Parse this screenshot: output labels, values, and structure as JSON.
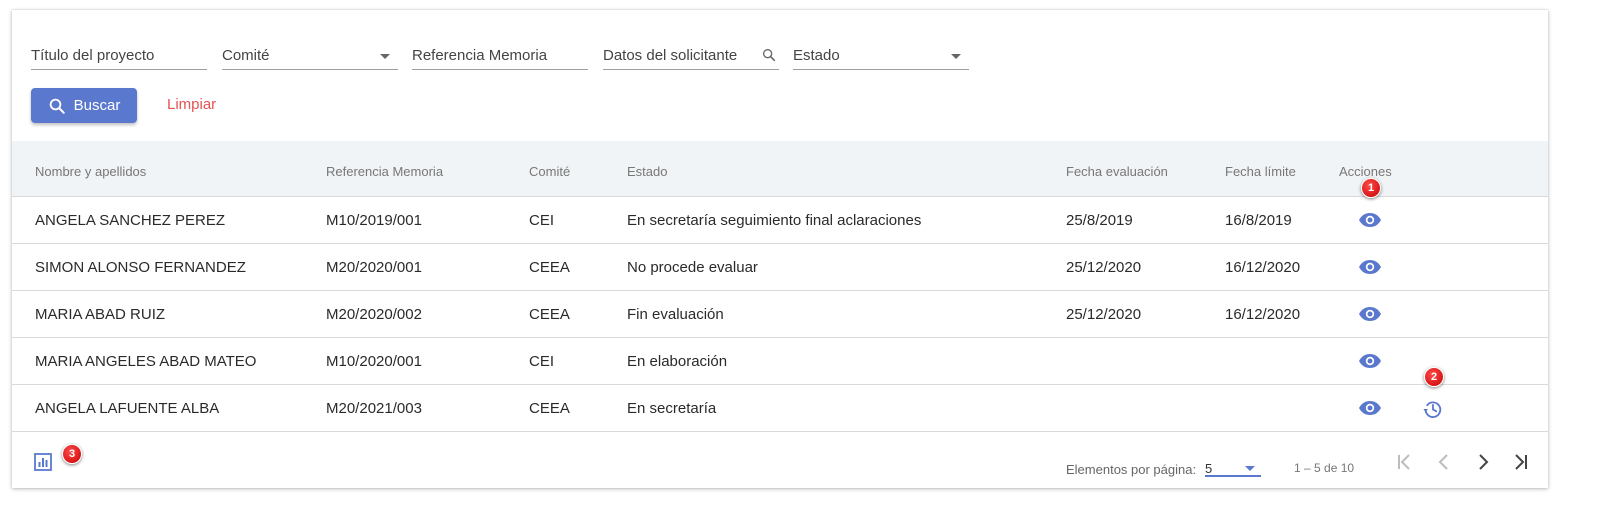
{
  "filters": {
    "titulo": "Título del proyecto",
    "comite": "Comité",
    "referencia": "Referencia Memoria",
    "solicitante": "Datos del solicitante",
    "estado": "Estado"
  },
  "buttons": {
    "buscar": "Buscar",
    "limpiar": "Limpiar"
  },
  "table": {
    "headers": [
      "Nombre y apellidos",
      "Referencia Memoria",
      "Comité",
      "Estado",
      "Fecha evaluación",
      "Fecha límite",
      "Acciones"
    ],
    "rows": [
      [
        "ANGELA SANCHEZ PEREZ",
        "M10/2019/001",
        "CEI",
        "En secretaría seguimiento final aclaraciones",
        "25/8/2019",
        "16/8/2019"
      ],
      [
        "SIMON ALONSO FERNANDEZ",
        "M20/2020/001",
        "CEEA",
        "No procede evaluar",
        "25/12/2020",
        "16/12/2020"
      ],
      [
        "MARIA ABAD RUIZ",
        "M20/2020/002",
        "CEEA",
        "Fin evaluación",
        "25/12/2020",
        "16/12/2020"
      ],
      [
        "MARIA ANGELES ABAD MATEO",
        "M10/2020/001",
        "CEI",
        "En elaboración",
        "",
        ""
      ],
      [
        "ANGELA LAFUENTE ALBA",
        "M20/2021/003",
        "CEEA",
        "En secretaría",
        "",
        ""
      ]
    ]
  },
  "markers": [
    "1",
    "2",
    "3"
  ],
  "paginator": {
    "label": "Elementos por página:",
    "page_size": "5",
    "range": "1 – 5 de 10"
  },
  "colors": {
    "accent": "#5b78cf",
    "danger": "#e55353",
    "marker": "#d00000"
  },
  "icons": [
    "search-icon",
    "eye-icon",
    "history-icon",
    "chart-icon",
    "first-page-icon",
    "prev-page-icon",
    "next-page-icon",
    "last-page-icon"
  ]
}
